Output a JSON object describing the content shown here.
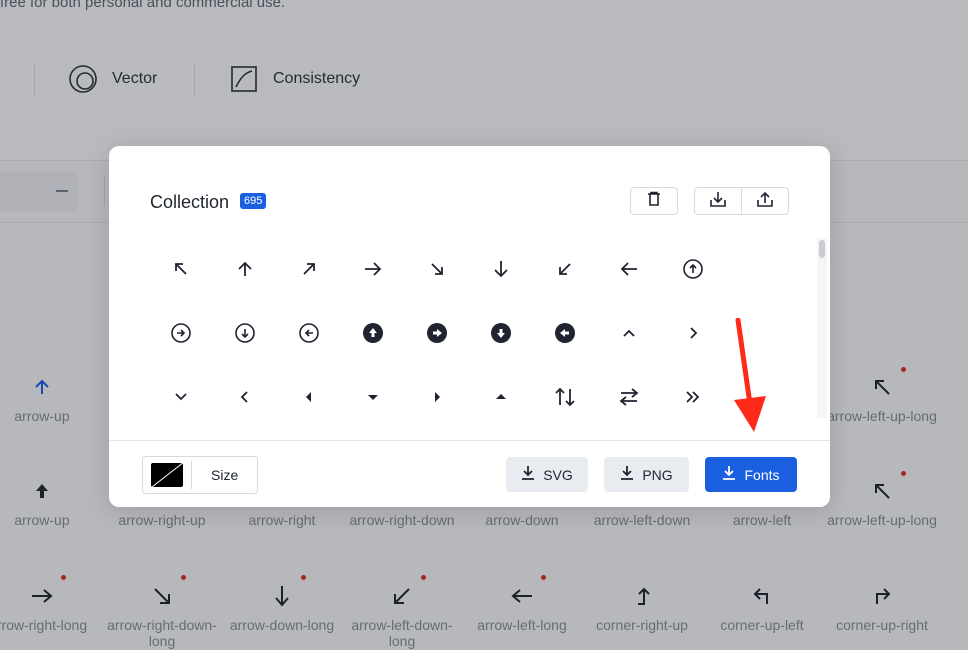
{
  "header": {
    "tagline": "free for both personal and commercial use.",
    "features": [
      {
        "icon": "vector-icon",
        "label": "Vector"
      },
      {
        "icon": "consistency-icon",
        "label": "Consistency"
      }
    ]
  },
  "grid": {
    "rows": [
      [
        {
          "label": "arrow-up",
          "icon": "arrow-up-icon",
          "new": false
        },
        {
          "label": "arrow-left-up-long",
          "icon": "arrow-left-up-long-icon",
          "new": true
        }
      ],
      [
        {
          "label": "arrow-up",
          "icon": "arrow-up-filled-icon",
          "new": false
        },
        {
          "label": "arrow-right-up",
          "icon": "",
          "new": false
        },
        {
          "label": "arrow-right",
          "icon": "",
          "new": false
        },
        {
          "label": "arrow-right-down",
          "icon": "",
          "new": false
        },
        {
          "label": "arrow-down",
          "icon": "",
          "new": false
        },
        {
          "label": "arrow-left-down",
          "icon": "",
          "new": false
        },
        {
          "label": "arrow-left",
          "icon": "",
          "new": false
        },
        {
          "label": "arrow-left-up-long",
          "icon": "arrow-left-up-long-icon",
          "new": true
        }
      ],
      [
        {
          "label": "rrow-right-long",
          "icon": "arrow-right-long-icon",
          "new": true
        },
        {
          "label": "arrow-right-down-long",
          "icon": "arrow-right-down-long-icon",
          "new": true
        },
        {
          "label": "arrow-down-long",
          "icon": "arrow-down-long-icon",
          "new": true
        },
        {
          "label": "arrow-left-down-long",
          "icon": "arrow-left-down-long-icon",
          "new": true
        },
        {
          "label": "arrow-left-long",
          "icon": "arrow-left-long-icon",
          "new": true
        },
        {
          "label": "corner-right-up",
          "icon": "corner-right-up-icon",
          "new": false
        },
        {
          "label": "corner-up-left",
          "icon": "corner-up-left-icon",
          "new": false
        },
        {
          "label": "corner-up-right",
          "icon": "corner-up-right-icon",
          "new": false
        }
      ]
    ]
  },
  "modal": {
    "title": "Collection",
    "count": "695",
    "toolbar": {
      "clear": "trash-icon",
      "import": "import-icon",
      "export": "export-icon"
    },
    "icons": [
      [
        "arrow-left-up-icon",
        "arrow-up-icon",
        "arrow-right-up-icon",
        "arrow-right-icon",
        "arrow-right-down-icon",
        "arrow-down-icon",
        "arrow-left-down-icon",
        "arrow-left-icon",
        "arrow-circle-up-icon"
      ],
      [
        "arrow-circle-right-icon",
        "arrow-circle-down-icon",
        "arrow-circle-left-icon",
        "arrow-circle-up-filled-icon",
        "arrow-circle-right-filled-icon",
        "arrow-circle-down-filled-icon",
        "arrow-circle-left-filled-icon",
        "chevron-up-icon",
        "chevron-right-icon"
      ],
      [
        "chevron-down-icon",
        "chevron-left-icon",
        "caret-left-icon",
        "caret-down-icon",
        "caret-right-icon",
        "caret-up-icon",
        "sort-icon",
        "switch-icon",
        "double-right-icon"
      ]
    ],
    "footer": {
      "size_label": "Size",
      "color": "#000000",
      "svg_label": "SVG",
      "png_label": "PNG",
      "fonts_label": "Fonts"
    }
  },
  "colors": {
    "accent": "#1a5fe0",
    "annotation": "#ff2a1a",
    "new_dot": "#d93025"
  }
}
